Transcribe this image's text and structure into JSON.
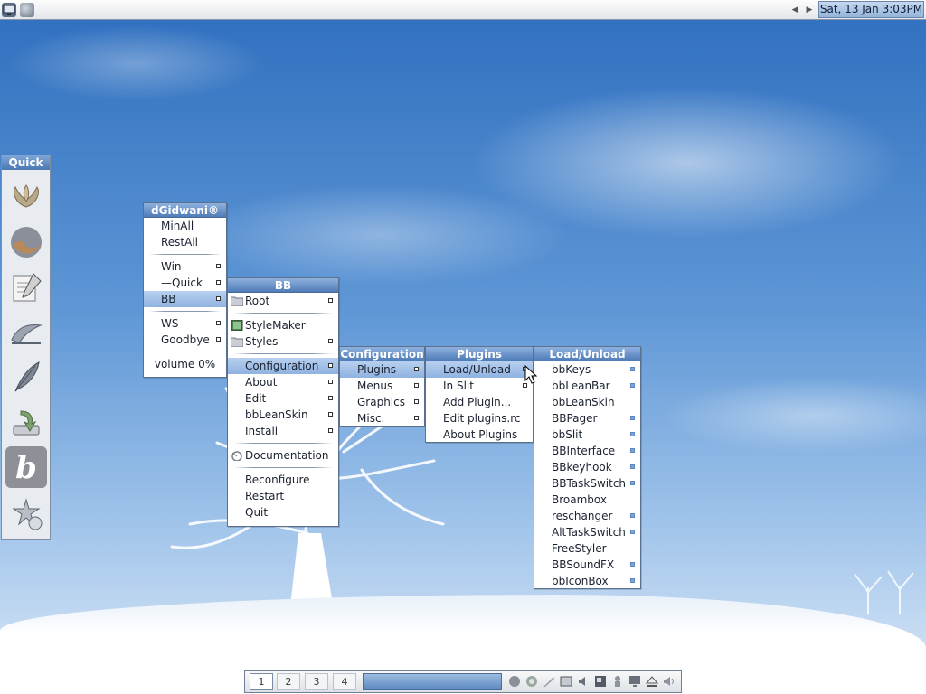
{
  "topbar": {
    "clock": "Sat, 13 Jan 3:03PM",
    "left_icons": [
      "computer-icon",
      "globe-icon"
    ],
    "nav_icons": [
      "arrow-left-icon",
      "arrow-right-icon"
    ]
  },
  "quick": {
    "title": "Quick",
    "icons": [
      "lotus-icon",
      "firefox-icon",
      "notepad-icon",
      "openoffice-icon",
      "feather-icon",
      "installer-icon",
      "blackbox-b-icon",
      "settings-icon"
    ]
  },
  "menus": {
    "main": {
      "title": "dGidwani®",
      "items": {
        "minall": "MinAll",
        "restall": "RestAll",
        "win": "Win",
        "quick": "—Quick",
        "bb": "BB",
        "ws": "WS",
        "goodbye": "Goodbye",
        "volume": "volume 0%"
      }
    },
    "bb": {
      "title": "BB",
      "items": {
        "root": "Root",
        "stylemaker": "StyleMaker",
        "styles": "Styles",
        "configuration": "Configuration",
        "about": "About",
        "edit": "Edit",
        "bbleanskin": "bbLeanSkin",
        "install": "Install",
        "documentation": "Documentation",
        "reconfigure": "Reconfigure",
        "restart": "Restart",
        "quit": "Quit"
      }
    },
    "configuration": {
      "title": "Configuration",
      "items": {
        "plugins": "Plugins",
        "menus": "Menus",
        "graphics": "Graphics",
        "misc": "Misc."
      }
    },
    "plugins": {
      "title": "Plugins",
      "items": {
        "load_unload": "Load/Unload",
        "in_slit": "In Slit",
        "add_plugin": "Add Plugin...",
        "edit_plugins": "Edit plugins.rc",
        "about_plugins": "About Plugins"
      }
    },
    "load_unload": {
      "title": "Load/Unload",
      "items": [
        {
          "label": "bbKeys",
          "checked": true
        },
        {
          "label": "bbLeanBar",
          "checked": true
        },
        {
          "label": "bbLeanSkin",
          "checked": false
        },
        {
          "label": "BBPager",
          "checked": true
        },
        {
          "label": "bbSlit",
          "checked": true
        },
        {
          "label": "BBInterface",
          "checked": true
        },
        {
          "label": "BBkeyhook",
          "checked": true
        },
        {
          "label": "BBTaskSwitch",
          "checked": true
        },
        {
          "label": "Broambox",
          "checked": false
        },
        {
          "label": "reschanger",
          "checked": true
        },
        {
          "label": "AltTaskSwitch",
          "checked": true
        },
        {
          "label": "FreeStyler",
          "checked": false
        },
        {
          "label": "BBSoundFX",
          "checked": true
        },
        {
          "label": "bbIconBox",
          "checked": true
        }
      ]
    }
  },
  "bottombar": {
    "workspaces": [
      "1",
      "2",
      "3",
      "4"
    ],
    "active_workspace": "1",
    "tray_icons": [
      "app-icon-1",
      "app-icon-2",
      "brush-icon",
      "window-icon",
      "speaker-icon",
      "window-icon-2",
      "chess-icon",
      "monitor-icon",
      "eject-icon",
      "volume-icon"
    ]
  }
}
